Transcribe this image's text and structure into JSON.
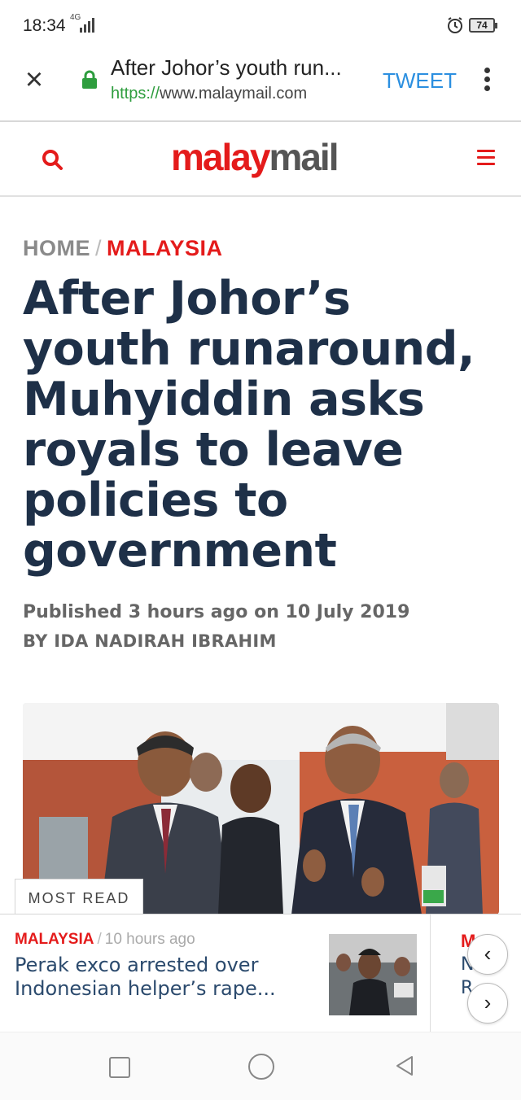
{
  "status_bar": {
    "time": "18:34",
    "network": "4G",
    "battery": "74"
  },
  "browser": {
    "title": "After Johor’s youth run...",
    "url_scheme": "https://",
    "url_host": "www.malaymail.com",
    "tweet_label": "TWEET"
  },
  "site": {
    "logo_part1": "malay",
    "logo_part2": "mail"
  },
  "breadcrumb": {
    "home": "HOME",
    "separator": "/",
    "section": "MALAYSIA"
  },
  "article": {
    "headline": "After Johor’s youth runaround, Muhyiddin asks royals to leave policies to government",
    "published": "Published 3 hours ago on 10 July 2019",
    "byline": "BY IDA NADIRAH IBRAHIM"
  },
  "most_read": {
    "tab_label": "MOST READ",
    "cards": [
      {
        "section": "MALAYSIA",
        "separator": "/",
        "time": "10 hours ago",
        "title": "Perak exco arrested over Indonesian helper’s rape..."
      }
    ],
    "next_card_peek": {
      "section": "M",
      "line2": "N",
      "line3": "R"
    }
  },
  "colors": {
    "brand_red": "#e41b1b",
    "headline_navy": "#1e3048",
    "link_blue": "#2b8fe0"
  },
  "icons": [
    "close-icon",
    "lock-icon",
    "kebab-menu-icon",
    "search-icon",
    "hamburger-menu-icon",
    "chevron-left-icon",
    "chevron-right-icon",
    "alarm-icon"
  ]
}
